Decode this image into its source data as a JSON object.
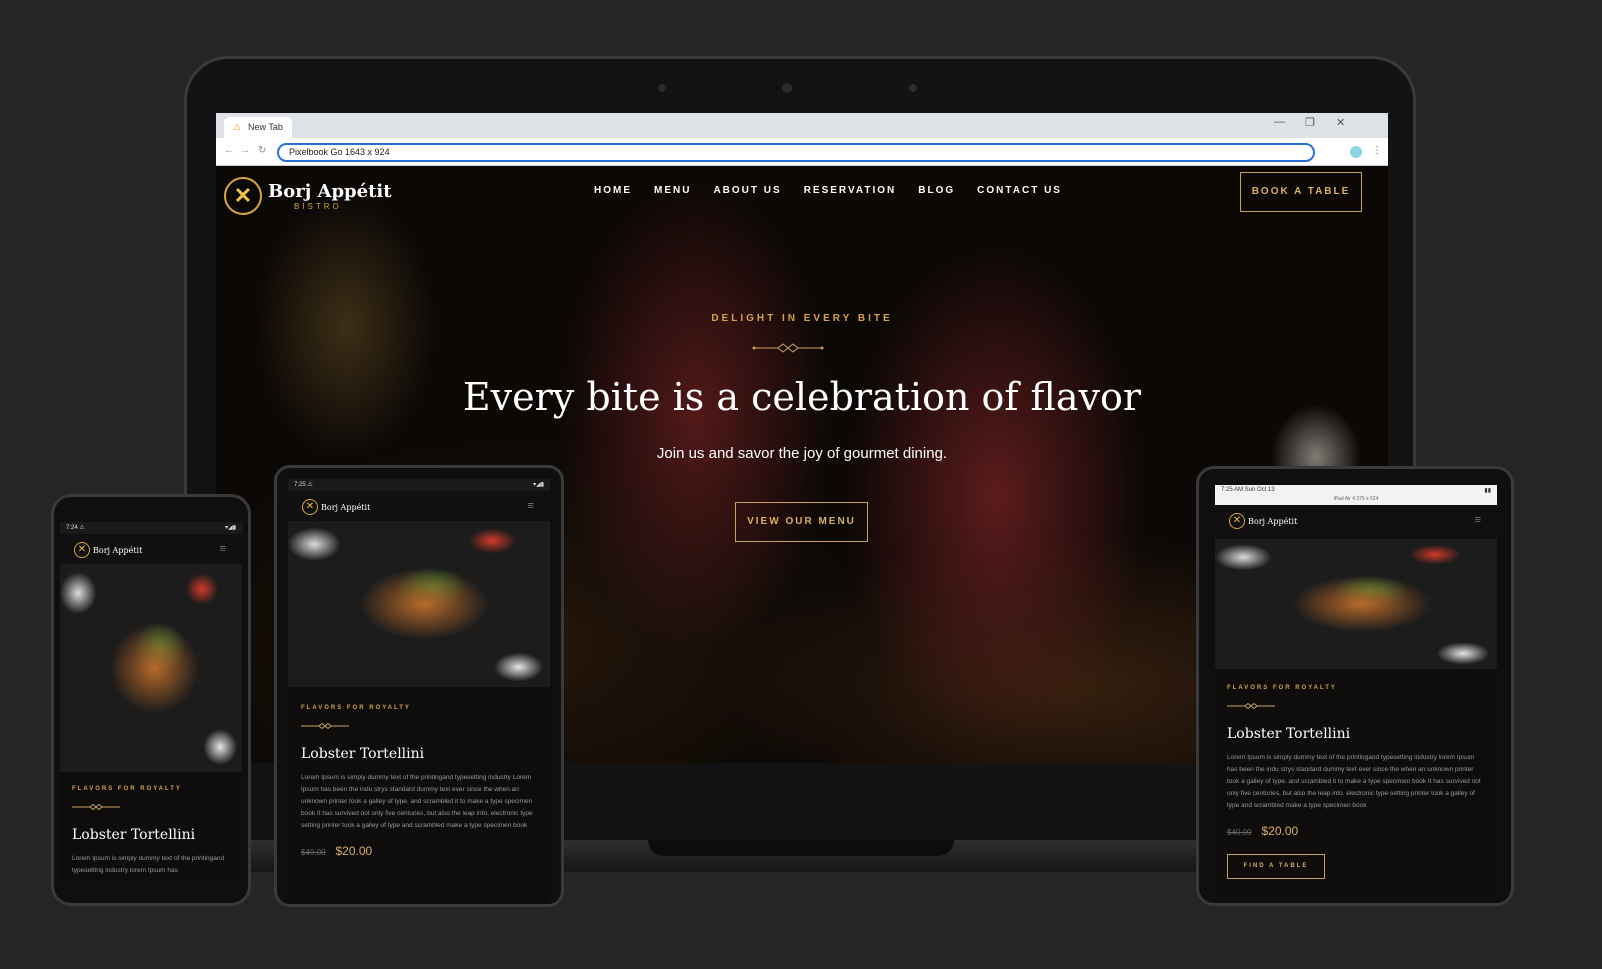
{
  "browser": {
    "tab_title": "New Tab",
    "url": "Pixelbook Go   1643 x 924"
  },
  "site": {
    "brand_name": "Borj Appétit",
    "brand_sub": "BISTRO",
    "nav": [
      "HOME",
      "MENU",
      "ABOUT US",
      "RESERVATION",
      "BLOG",
      "CONTACT US"
    ],
    "cta": "BOOK A TABLE",
    "hero_tagline": "DELIGHT IN EVERY BITE",
    "hero_title": "Every bite is a celebration of flavor",
    "hero_subtitle": "Join us and savor the joy of gourmet dining.",
    "hero_button": "VIEW OUR MENU"
  },
  "phone": {
    "time": "7:24",
    "kicker": "FLAVORS FOR ROYALTY",
    "dish": "Lobster Tortellini",
    "desc": "Lorem Ipsum is simply dummy text of the printingand typesetting industry lorem Ipsum has"
  },
  "tablet": {
    "time": "7:25",
    "kicker": "FLAVORS FOR ROYALTY",
    "dish": "Lobster Tortellini",
    "desc": "Lorem Ipsum is simply dummy text of the printingand typesetting industry Lorem Ipsum has been the indu strys standard dummy text ever since the when an unknown printer took a galley of type. and scrambled it to make a type specimen book It has survived not only five centuries, but also the leap into. electronic type setting printer took a galley of type and scrambled make a type specimen book",
    "old_price": "$40.00",
    "new_price": "$20.00"
  },
  "ipad": {
    "status_left": "7:25 AM Sun Oct 13",
    "status_center": "iPad Air 4  375 x 624",
    "kicker": "FLAVORS FOR ROYALTY",
    "dish": "Lobster Tortellini",
    "desc": "Lorem Ipsum is simply dummy text of the printingand typesetting industry lorem Ipsum has been the indu strys standard dummy text ever since the when an unknown printer took a galley of type. and scrambled it to make a type specimen book It has survived not only five centuries, but also the leap into. electronic type setting printer took a galley of type and scrambled make a type specimen book",
    "old_price": "$40.00",
    "new_price": "$20.00",
    "button": "FIND A TABLE"
  },
  "colors": {
    "accent": "#d4a34a",
    "background": "#252527"
  },
  "icons": [
    "warning-icon",
    "minimize-icon",
    "restore-icon",
    "close-icon",
    "back-icon",
    "forward-icon",
    "reload-icon",
    "menu-icon"
  ]
}
